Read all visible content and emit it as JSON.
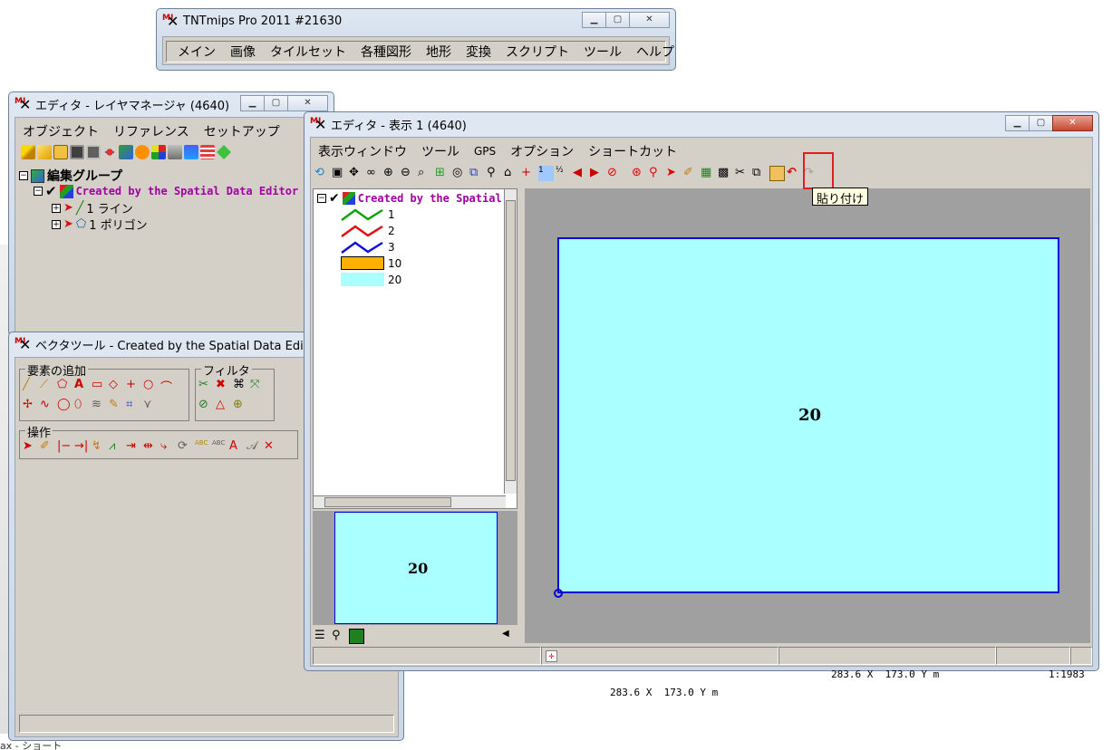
{
  "main_window": {
    "title": "TNTmips Pro 2011  #21630",
    "menu": [
      "メイン",
      "画像",
      "タイルセット",
      "各種図形",
      "地形",
      "変換",
      "スクリプト",
      "ツール",
      "ヘルプ"
    ]
  },
  "layer_manager": {
    "title": "エディタ - レイヤマネージャ (4640)",
    "menu": [
      "オブジェクト",
      "リファレンス",
      "セットアップ"
    ],
    "tree": {
      "group": "編集グループ",
      "object": "Created by the Spatial Data Editor",
      "layers": [
        "1 ライン",
        "1 ポリゴン"
      ]
    }
  },
  "vector_tools": {
    "title": "ベクタツール - Created by the Spatial Data Edito...",
    "groups": {
      "add": "要素の追加",
      "filter": "フィルタ",
      "ops": "操作"
    }
  },
  "display_window": {
    "title": "エディタ - 表示 1 (4640)",
    "menu": [
      "表示ウィンドウ",
      "ツール",
      "GPS",
      "オプション",
      "ショートカット"
    ],
    "tooltip": "貼り付け",
    "legend": {
      "object": "Created by the Spatial D",
      "items": [
        {
          "label": "1",
          "kind": "line",
          "color": "#10a010"
        },
        {
          "label": "2",
          "kind": "line",
          "color": "#e01010"
        },
        {
          "label": "3",
          "kind": "line",
          "color": "#1010e0"
        },
        {
          "label": "10",
          "kind": "fill",
          "color": "#ffb000"
        },
        {
          "label": "20",
          "kind": "fill",
          "color": "#aaffff"
        }
      ]
    },
    "overview_label": "20",
    "map_label": "20",
    "status": {
      "coords1": "283.6 X  173.0 Y m",
      "coords2": "283.6 X  173.0 Y m",
      "scale": "1:1983"
    },
    "colors": {
      "polygon_fill": "#aaffff",
      "polygon_border": "#0000dd",
      "canvas_bg": "#a0a0a0",
      "highlight": "#e02020"
    }
  },
  "desktop_fragments": [
    "ax - ショート"
  ]
}
